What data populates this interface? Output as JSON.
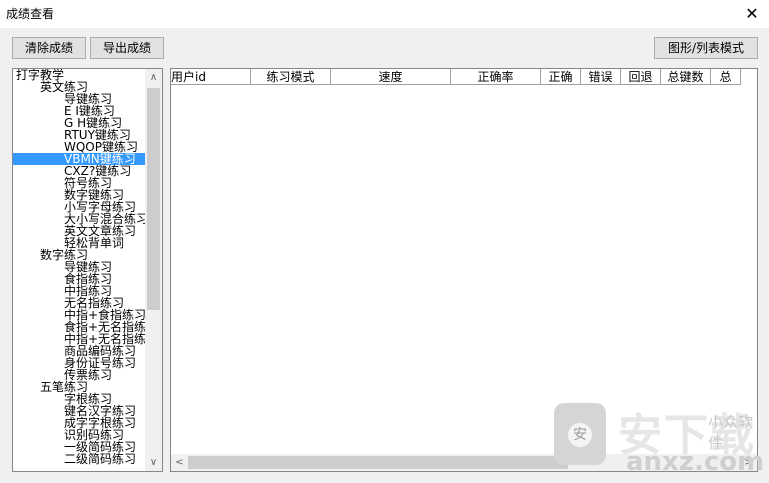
{
  "window": {
    "title": "成绩查看",
    "close_glyph": "✕"
  },
  "toolbar": {
    "clear_label": "清除成绩",
    "export_label": "导出成绩",
    "mode_label": "图形/列表模式"
  },
  "tree": {
    "items": [
      {
        "label": "打字教学",
        "level": 0
      },
      {
        "label": "英文练习",
        "level": 1
      },
      {
        "label": "导键练习",
        "level": 2
      },
      {
        "label": "E I键练习",
        "level": 2
      },
      {
        "label": "G H键练习",
        "level": 2
      },
      {
        "label": "RTUY键练习",
        "level": 2
      },
      {
        "label": "WQOP键练习",
        "level": 2
      },
      {
        "label": "VBMN键练习",
        "level": 2,
        "selected": true
      },
      {
        "label": "CXZ?键练习",
        "level": 2
      },
      {
        "label": "符号练习",
        "level": 2
      },
      {
        "label": "数字键练习",
        "level": 2
      },
      {
        "label": "小写字母练习",
        "level": 2
      },
      {
        "label": "大小写混合练习",
        "level": 2
      },
      {
        "label": "英文文章练习",
        "level": 2
      },
      {
        "label": "轻松背单词",
        "level": 2
      },
      {
        "label": "数字练习",
        "level": 1
      },
      {
        "label": "导键练习",
        "level": 2
      },
      {
        "label": "食指练习",
        "level": 2
      },
      {
        "label": "中指练习",
        "level": 2
      },
      {
        "label": "无名指练习",
        "level": 2
      },
      {
        "label": "中指+食指练习",
        "level": 2
      },
      {
        "label": "食指+无名指练习",
        "level": 2
      },
      {
        "label": "中指+无名指练习",
        "level": 2
      },
      {
        "label": "商品编码练习",
        "level": 2
      },
      {
        "label": "身份证号练习",
        "level": 2
      },
      {
        "label": "传票练习",
        "level": 2
      },
      {
        "label": "五笔练习",
        "level": 1
      },
      {
        "label": "字根练习",
        "level": 2
      },
      {
        "label": "键名汉字练习",
        "level": 2
      },
      {
        "label": "成字字根练习",
        "level": 2
      },
      {
        "label": "识别码练习",
        "level": 2
      },
      {
        "label": "一级简码练习",
        "level": 2
      },
      {
        "label": "二级简码练习",
        "level": 2
      }
    ]
  },
  "table": {
    "columns": [
      "用户id",
      "练习模式",
      "速度",
      "正确率",
      "正确",
      "错误",
      "回退",
      "总键数",
      "总"
    ]
  },
  "scroll": {
    "up": "∧",
    "down": "∨",
    "left": "<",
    "right": ">"
  },
  "watermark": {
    "text": "安下载",
    "url": "anxz.com",
    "sub": "小众软件"
  },
  "icons": {
    "close": "close-icon",
    "watermark": "bag-icon"
  }
}
